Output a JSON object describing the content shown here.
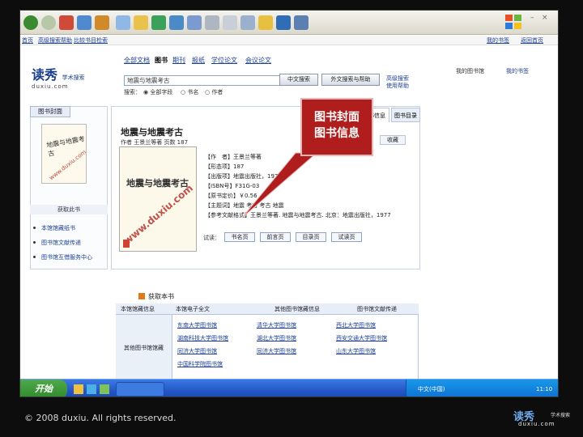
{
  "browser": {
    "toolbar_icons": [
      "back-icon",
      "forward-icon",
      "stop-icon",
      "refresh-icon",
      "home-icon",
      "search-icon",
      "favorites-icon",
      "media-icon",
      "history-icon",
      "mail-icon",
      "print-icon",
      "edit-icon",
      "discuss-icon",
      "folder-icon",
      "messenger-icon",
      "research-icon"
    ]
  },
  "linkbar": {
    "items": [
      "首页",
      "高级搜索帮助",
      "比较书目检索"
    ],
    "right": [
      "我的书签",
      "返回首页"
    ]
  },
  "header": {
    "logo_text": "读秀",
    "logo_sub": "学术搜索",
    "logo_domain": "duxiu.com",
    "categories": [
      "全部文档",
      "图书",
      "期刊",
      "报纸",
      "学位论文",
      "会议论文"
    ],
    "search_value": "地震与地震考古",
    "search_btn": "中文搜索",
    "search_btn2": "外文搜索与帮助",
    "help_link1": "高级搜索",
    "help_link2": "使用帮助",
    "options_label": "搜索：",
    "options": [
      "全部字段",
      "书名",
      "作者"
    ],
    "user_links": [
      "我的图书馆",
      "我的书签"
    ]
  },
  "left_panel": {
    "tab": "图书封面",
    "thumb_title": "地震与地震考古",
    "watermark": "www.duxiu.com",
    "section_title": "获取此书",
    "links": [
      "本馆馆藏纸书",
      "图书馆文献传递",
      "图书馆互借服务中心"
    ]
  },
  "main_panel": {
    "tabs": [
      "图书信息",
      "图书目录"
    ],
    "title": "地震与地震考古",
    "subtitle": "作者 王景兰等著  页数 187",
    "fav_btn": "收藏",
    "meta": [
      "【作　者】王景兰等著",
      "【形态项】187",
      "【出版项】地震出版社，1977",
      "【ISBN号】F31G-03",
      "【原书定价】￥0.56",
      "【主题词】地震  考古  考古  地震",
      "【参考文献格式】王景兰等著. 地震与地震考古. 北京：地震出版社，1977"
    ],
    "try_read_label": "试读：",
    "try_read_buttons": [
      "书名页",
      "前言页",
      "目录页",
      "试读页"
    ]
  },
  "callout": {
    "line1": "图书封面",
    "line2": "图书信息"
  },
  "library_section": {
    "title": "获取本书",
    "headers": [
      "本馆馆藏信息",
      "本馆电子全文",
      "其他图书馆藏信息",
      "图书馆文献传递"
    ],
    "left_label": "其他图书馆馆藏",
    "rows": [
      [
        "东南大学图书馆",
        "清华大学图书馆",
        "西北大学图书馆"
      ],
      [
        "湖南科技大学图书馆",
        "湖北大学图书馆",
        "西安交通大学图书馆"
      ],
      [
        "同济大学图书馆",
        "同济大学图书馆",
        "山东大学图书馆"
      ],
      [
        "中国科学院图书馆",
        "",
        ""
      ]
    ]
  },
  "taskbar": {
    "start": "开始",
    "lang": "中文(中国)",
    "time": "11:10"
  },
  "slide": {
    "copyright": "© 2008 duxiu. All rights reserved.",
    "brand_name": "读秀",
    "brand_domain": "duxiu.com",
    "brand_tag": "学术搜索"
  },
  "colors": {
    "link": "#1c3f95",
    "callout_bg": "#b01d1d",
    "taskbar": "#2457c5",
    "start": "#3a9a37"
  }
}
